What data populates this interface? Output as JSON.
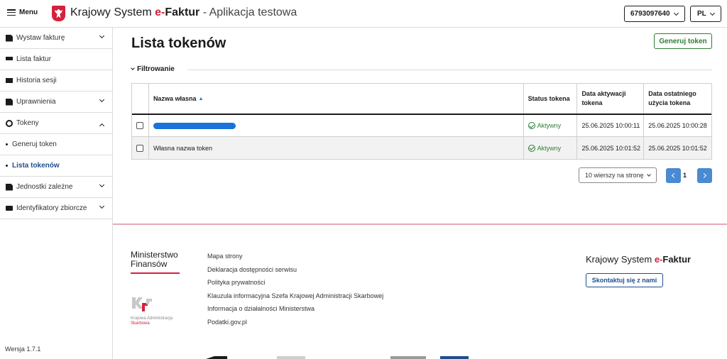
{
  "header": {
    "menu_label": "Menu",
    "title_prefix": "Krajowy System ",
    "title_e": "e-",
    "title_brand": "Faktur",
    "title_suffix": " - Aplikacja testowa",
    "nip": "6793097640",
    "language": "PL"
  },
  "sidebar": {
    "items": [
      {
        "label": "Wystaw fakturę",
        "icon": "document-icon",
        "expandable": true
      },
      {
        "label": "Lista faktur",
        "icon": "list-icon",
        "expandable": false
      },
      {
        "label": "Historia sesji",
        "icon": "mail-icon",
        "expandable": false
      },
      {
        "label": "Uprawnienia",
        "icon": "document-icon",
        "expandable": true
      },
      {
        "label": "Tokeny",
        "icon": "key-icon",
        "expanded": true
      }
    ],
    "tokens_sub": [
      {
        "label": "Generuj token"
      },
      {
        "label": "Lista tokenów",
        "active": true
      }
    ],
    "items_after": [
      {
        "label": "Jednostki zależne",
        "icon": "document-icon",
        "expandable": true
      },
      {
        "label": "Identyfikatory zbiorcze",
        "icon": "id-card-icon",
        "expandable": true
      }
    ],
    "version": "Wersja 1.7.1"
  },
  "main": {
    "title": "Lista tokenów",
    "generate_button": "Generuj token",
    "filter_label": "Filtrowanie",
    "table": {
      "columns": [
        "Nazwa własna",
        "Status tokena",
        "Data aktywacji tokena",
        "Data ostatniego użycia tokena"
      ],
      "rows": [
        {
          "name": "",
          "redacted": true,
          "status": "Aktywny",
          "activated": "25.06.2025 10:00:11",
          "last_used": "25.06.2025 10:00:28"
        },
        {
          "name": "Własna nazwa token",
          "redacted": false,
          "status": "Aktywny",
          "activated": "25.06.2025 10:01:52",
          "last_used": "25.06.2025 10:01:52"
        }
      ]
    },
    "pagination": {
      "per_page": "10 wierszy na stronę",
      "current_page": "1"
    }
  },
  "footer": {
    "mf_line1": "Ministerstwo",
    "mf_line2": "Finansów",
    "kas_line1": "Krajowa Administracja",
    "kas_line2": "Skarbowa",
    "links": [
      "Mapa strony",
      "Deklaracja dostępności serwisu",
      "Polityka prywatności",
      "Klauzula informacyjna Szefa Krajowej Administracji Skarbowej",
      "Informacja o działalności Ministerstwa",
      "Podatki.gov.pl"
    ],
    "brand_prefix": "Krajowy System ",
    "brand_e": "e-",
    "brand_name": "Faktur",
    "contact_button": "Skontaktuj się z nami"
  },
  "colors": {
    "accent_red": "#d4213d",
    "success_green": "#2e7d32",
    "link_blue": "#1f4e8c",
    "pager_blue": "#4a8ad1"
  }
}
